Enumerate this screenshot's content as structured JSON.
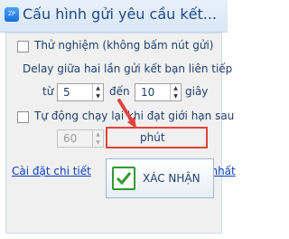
{
  "window": {
    "title": "Cấu hình gửi yêu cầu kết...",
    "app_icon": "app-logo-icon"
  },
  "options": {
    "test_mode_label": "Thử nghiệm (không bấm nút gửi)",
    "delay_label": "Delay giữa hai lần gửi kết bạn liên tiếp",
    "from_label": "từ",
    "from_value": "5",
    "to_label": "đến",
    "to_value": "10",
    "unit_seconds": "giây",
    "auto_run_label": "Tự động chạy lại khi đạt giới hạn sau",
    "auto_run_value": "60",
    "unit_minutes": "phút"
  },
  "links": {
    "settings_detail": "Cài đặt chi tiết",
    "get_new_config": "Lấy cấu hình mới nhất"
  },
  "buttons": {
    "confirm": "XÁC NHẬN"
  },
  "annotation": {
    "highlight_color": "#e0443c"
  }
}
